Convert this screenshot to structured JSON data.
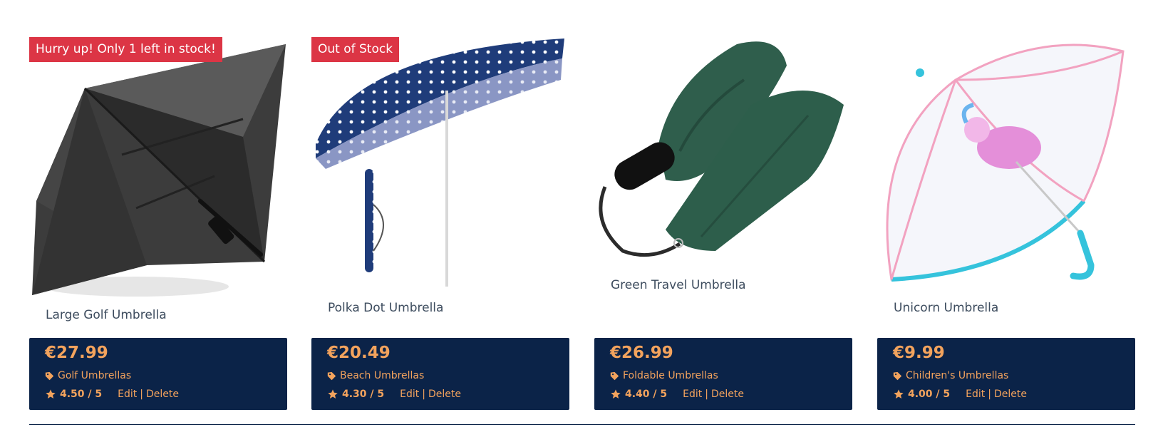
{
  "colors": {
    "accent": "#f3a35d",
    "panel": "#0b2348",
    "badge": "#dc3545",
    "title": "#3d4c5e"
  },
  "products": [
    {
      "badge": "Hurry up! Only 1 left in stock!",
      "title": "Large Golf Umbrella",
      "price": "€27.99",
      "category": "Golf Umbrellas",
      "rating": "4.50 / 5",
      "edit": "Edit",
      "delete": "Delete",
      "separator": "|"
    },
    {
      "badge": "Out of Stock",
      "title": "Polka Dot Umbrella",
      "price": "€20.49",
      "category": "Beach Umbrellas",
      "rating": "4.30 / 5",
      "edit": "Edit",
      "delete": "Delete",
      "separator": "|"
    },
    {
      "title": "Green Travel Umbrella",
      "price": "€26.99",
      "category": "Foldable Umbrellas",
      "rating": "4.40 / 5",
      "edit": "Edit",
      "delete": "Delete",
      "separator": "|"
    },
    {
      "title": "Unicorn Umbrella",
      "price": "€9.99",
      "category": "Children's Umbrellas",
      "rating": "4.00 / 5",
      "edit": "Edit",
      "delete": "Delete",
      "separator": "|"
    }
  ]
}
